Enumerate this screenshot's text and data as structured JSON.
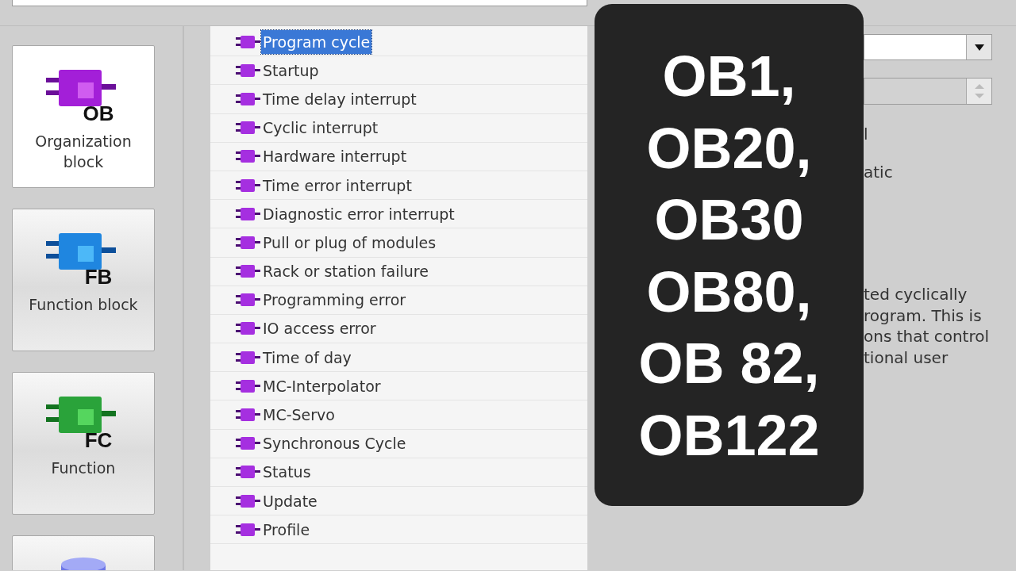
{
  "block_types": [
    {
      "kind": "ob",
      "badge": "OB",
      "label": "Organization block",
      "selected": true
    },
    {
      "kind": "fb",
      "badge": "FB",
      "label": "Function block",
      "selected": false
    },
    {
      "kind": "fc",
      "badge": "FC",
      "label": "Function",
      "selected": false
    },
    {
      "kind": "db",
      "selected": false
    }
  ],
  "ob_types": [
    {
      "label": "Program cycle",
      "selected": true
    },
    {
      "label": "Startup",
      "selected": false
    },
    {
      "label": "Time delay interrupt",
      "selected": false
    },
    {
      "label": "Cyclic interrupt",
      "selected": false
    },
    {
      "label": "Hardware interrupt",
      "selected": false
    },
    {
      "label": "Time error interrupt",
      "selected": false
    },
    {
      "label": "Diagnostic error interrupt",
      "selected": false
    },
    {
      "label": "Pull or plug of modules",
      "selected": false
    },
    {
      "label": "Rack or station failure",
      "selected": false
    },
    {
      "label": "Programming error",
      "selected": false
    },
    {
      "label": "IO access error",
      "selected": false
    },
    {
      "label": "Time of day",
      "selected": false
    },
    {
      "label": "MC-Interpolator",
      "selected": false
    },
    {
      "label": "MC-Servo",
      "selected": false
    },
    {
      "label": "Synchronous Cycle",
      "selected": false
    },
    {
      "label": "Status",
      "selected": false
    },
    {
      "label": "Update",
      "selected": false
    },
    {
      "label": "Profile",
      "selected": false
    }
  ],
  "properties": {
    "label_fragments": [
      "l",
      "atic"
    ],
    "description": "ted cyclically\nrogram. This is\nons that control\ntional user"
  },
  "overlay": {
    "lines": [
      "OB1,",
      "OB20,",
      "OB30",
      "OB80,",
      "OB 82,",
      "OB122"
    ]
  }
}
